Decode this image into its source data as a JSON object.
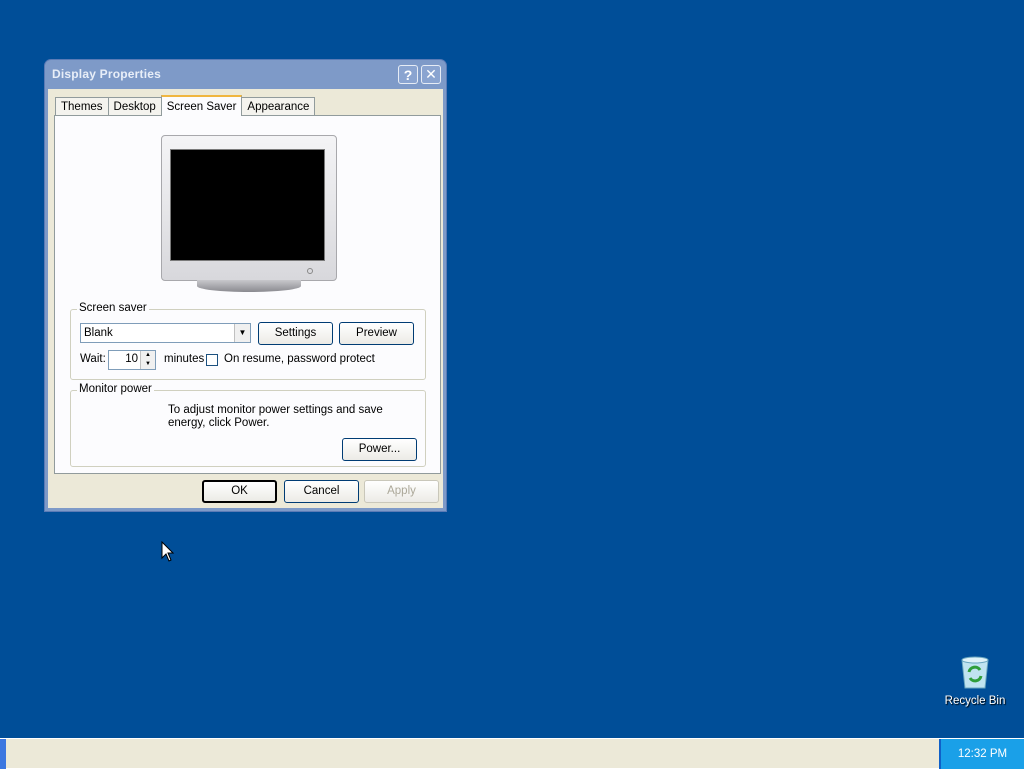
{
  "window": {
    "title": "Display Properties",
    "help_label": "?",
    "close_label": "✕"
  },
  "tabs": [
    {
      "label": "Themes",
      "active": false
    },
    {
      "label": "Desktop",
      "active": false
    },
    {
      "label": "Screen Saver",
      "active": true
    },
    {
      "label": "Appearance",
      "active": false
    }
  ],
  "screensaver": {
    "group_label": "Screen saver",
    "selected": "Blank",
    "settings_label": "Settings",
    "preview_label": "Preview",
    "wait_label": "Wait:",
    "wait_value": "10",
    "minutes_label": "minutes",
    "password_label": "On resume, password protect",
    "password_checked": false
  },
  "power": {
    "group_label": "Monitor power",
    "description": "To adjust monitor power settings and save energy, click Power.",
    "button_label": "Power..."
  },
  "buttons": {
    "ok": "OK",
    "cancel": "Cancel",
    "apply": "Apply"
  },
  "desktop": {
    "recycle_bin_label": "Recycle Bin",
    "background_color": "#004e98"
  },
  "taskbar": {
    "clock": "12:32 PM"
  }
}
